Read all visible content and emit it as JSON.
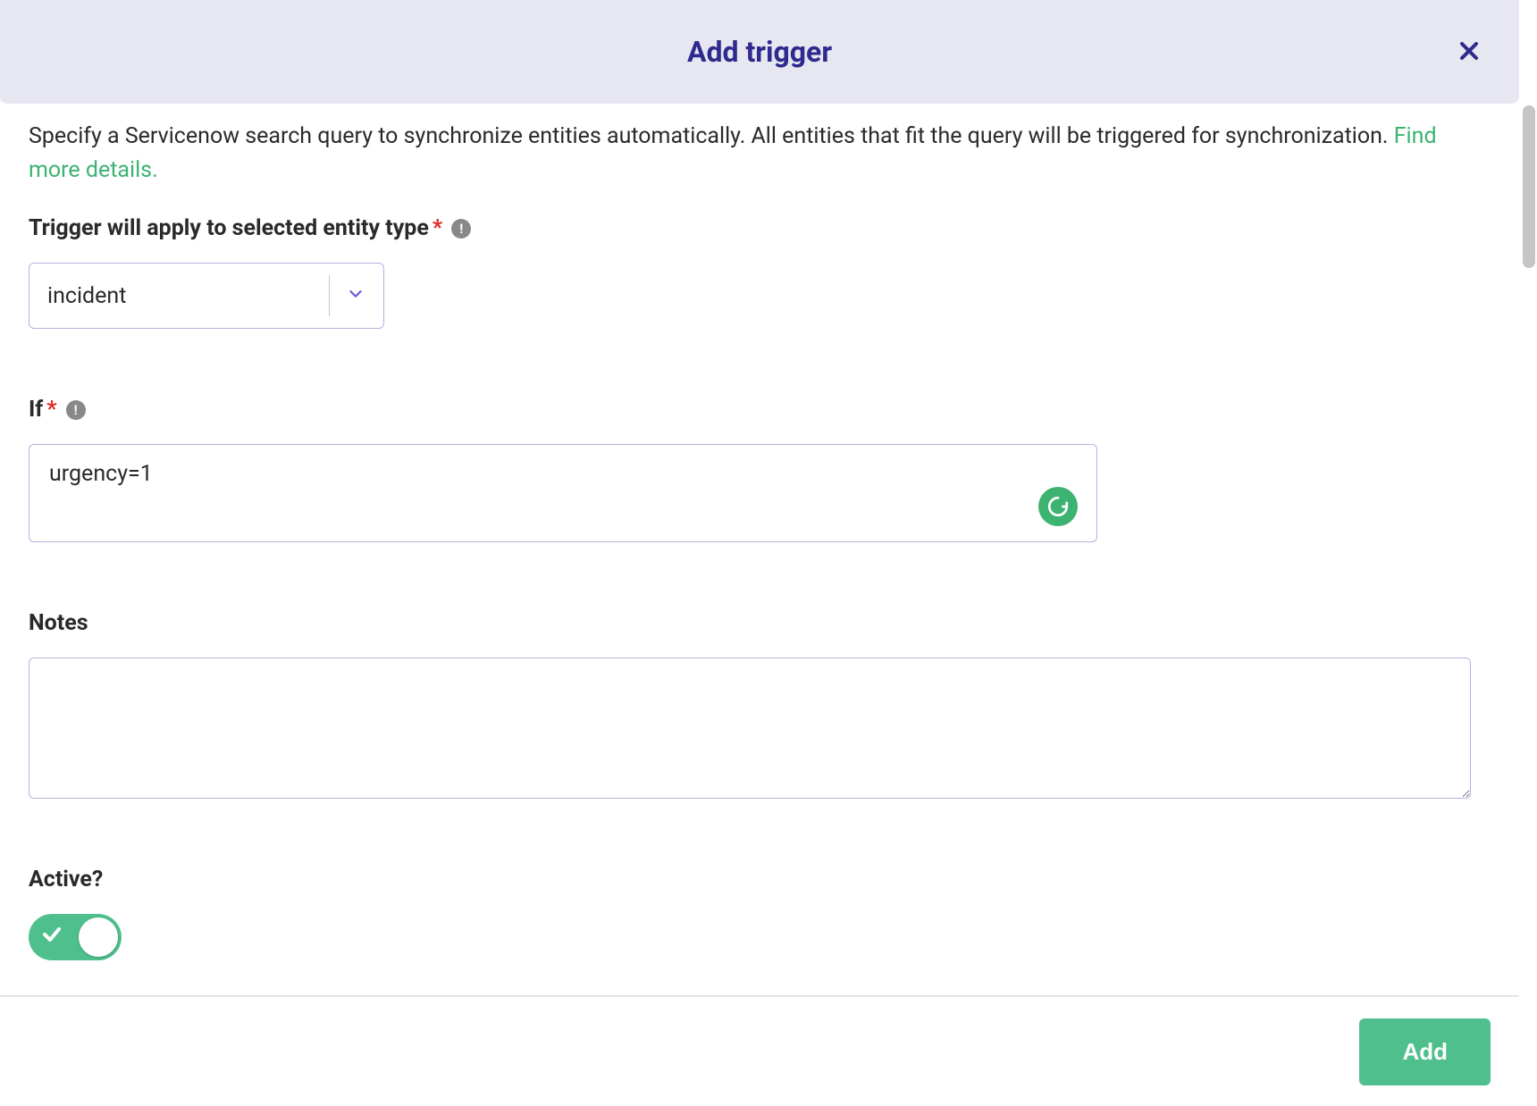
{
  "header": {
    "title": "Add trigger"
  },
  "description": {
    "text_before": "Specify a Servicenow search query to synchronize entities automatically. All entities that fit the query will be triggered for synchronization. ",
    "link_text": "Find more details."
  },
  "fields": {
    "entity_type": {
      "label": "Trigger will apply to selected entity type",
      "required": "*",
      "value": "incident"
    },
    "if": {
      "label": "If",
      "required": "*",
      "value": "urgency=1"
    },
    "notes": {
      "label": "Notes",
      "value": ""
    },
    "active": {
      "label": "Active?",
      "value": true
    }
  },
  "footer": {
    "add_button": "Add"
  }
}
